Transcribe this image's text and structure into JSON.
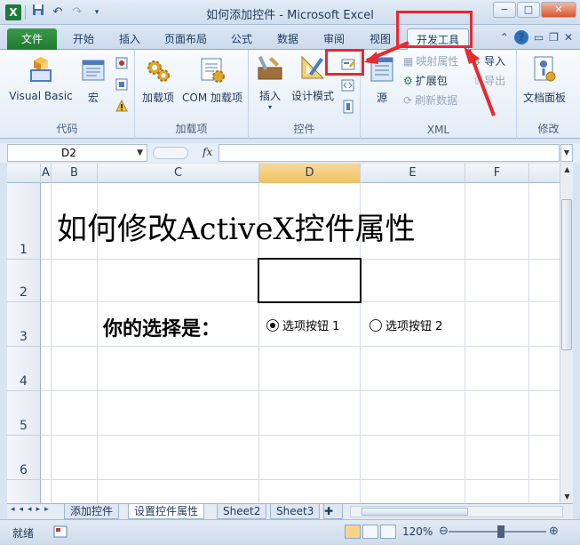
{
  "window": {
    "title": "如何添加控件 - Microsoft Excel",
    "app_icon": "X",
    "minimize": "−",
    "maximize": "□",
    "close": "✕"
  },
  "tabs": [
    "文件",
    "开始",
    "插入",
    "页面布局",
    "公式",
    "数据",
    "审阅",
    "视图",
    "开发工具"
  ],
  "active_tab": "开发工具",
  "ribbon": {
    "groups": {
      "code": "代码",
      "addins": "加载项",
      "controls": "控件",
      "xml": "XML",
      "modify": "修改"
    },
    "buttons": {
      "visual_basic": "Visual Basic",
      "macros": "宏",
      "addins": "加载项",
      "com_addins": "COM 加载项",
      "insert": "插入",
      "design_mode": "设计模式",
      "source": "源",
      "map_properties": "映射属性",
      "expansion_packs": "扩展包",
      "refresh_data": "刷新数据",
      "import": "导入",
      "export": "导出",
      "document_panel": "文档面板"
    }
  },
  "formula_bar": {
    "name_box": "D2",
    "fx": "fx",
    "value": ""
  },
  "columns": [
    "A",
    "B",
    "C",
    "D",
    "E",
    "F"
  ],
  "selected_column": "D",
  "rows": [
    "1",
    "2",
    "3",
    "4",
    "5",
    "6"
  ],
  "cells": {
    "title": "如何修改ActiveX控件属性",
    "question": "你的选择是：",
    "option1": "选项按钮 1",
    "option2": "选项按钮 2"
  },
  "option1_selected": true,
  "sheet_tabs": [
    "添加控件",
    "设置控件属性",
    "Sheet2",
    "Sheet3"
  ],
  "active_sheet": "设置控件属性",
  "status": {
    "ready": "就绪",
    "zoom": "120%"
  },
  "colors": {
    "annotation": "#e8292e",
    "file_tab": "#1f7a2f",
    "ribbon_bg": "#e3ecf7"
  }
}
